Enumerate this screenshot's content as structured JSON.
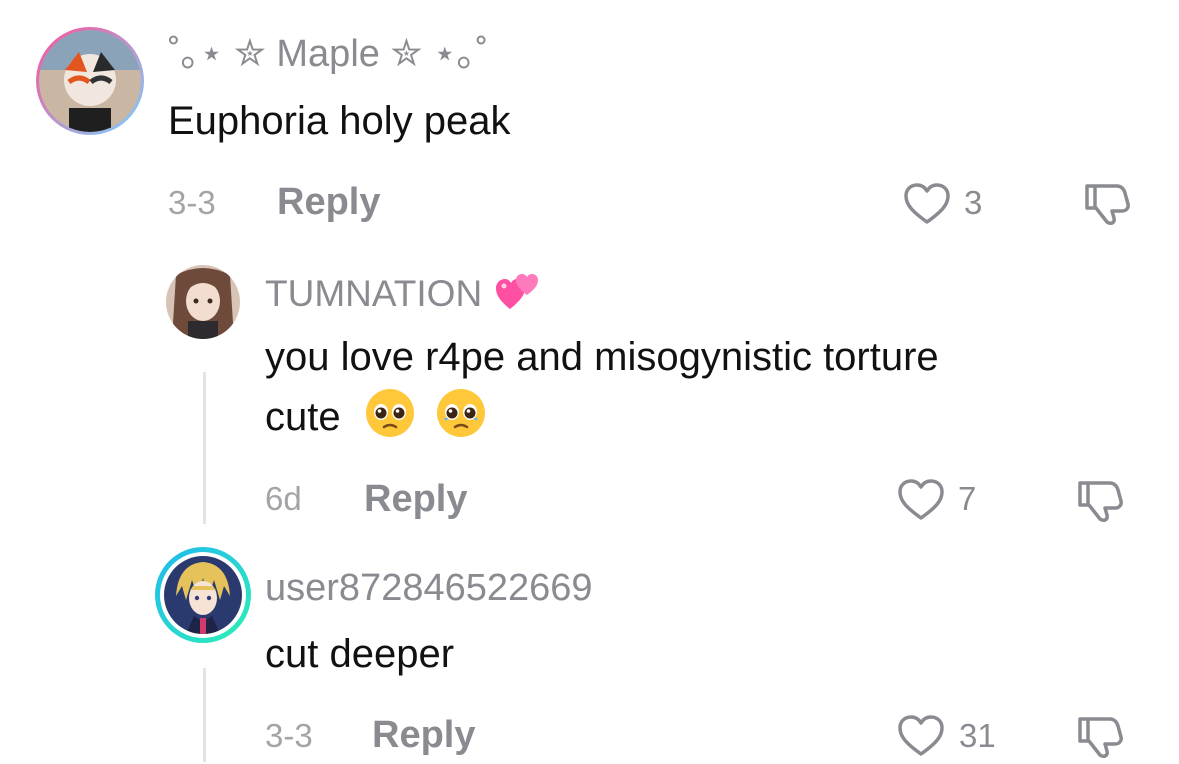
{
  "comments": [
    {
      "username": "˚｡⋆ ✮ Maple ✮ ⋆｡˚",
      "text": "Euphoria holy peak",
      "date": "3-3",
      "reply_label": "Reply",
      "likes": "3"
    },
    {
      "username": "TUMNATION",
      "username_emoji": "two-hearts",
      "text_line1": "you love r4pe and misogynistic torture",
      "text_line2": "cute",
      "text_emojis": [
        "pleading-face",
        "pleading-face"
      ],
      "date": "6d",
      "reply_label": "Reply",
      "likes": "7"
    },
    {
      "username": "user872846522669",
      "text": "cut deeper",
      "date": "3-3",
      "reply_label": "Reply",
      "likes": "31"
    }
  ],
  "colors": {
    "text": "#111111",
    "muted": "#8a8b91",
    "story_ring": "#20d5c8"
  }
}
